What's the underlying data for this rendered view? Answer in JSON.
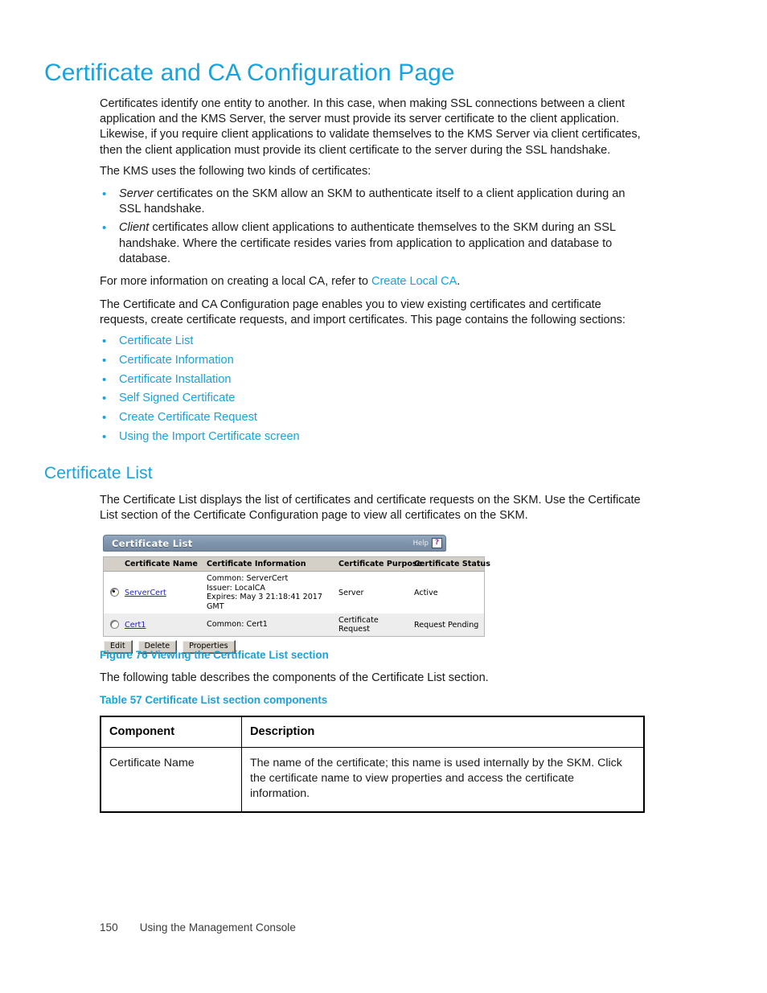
{
  "page": {
    "title": "Certificate and CA Configuration Page",
    "section_heading": "Certificate List",
    "accent_color": "#17a3dc",
    "intro_paragraph": "Certificates identify one entity to another. In this case, when making SSL connections between a client application and the KMS Server, the server must provide its server certificate to the client application. Likewise, if you require client applications to validate themselves to the KMS Server via client certificates, then the client application must provide its client certificate to the server during the SSL handshake.",
    "kinds_lead": "The KMS uses the following two kinds of certificates:",
    "kinds": [
      {
        "emphasis": "Server",
        "rest": " certificates on the SKM allow an SKM to authenticate itself to a client application during an SSL handshake."
      },
      {
        "emphasis": "Client",
        "rest": " certificates allow client applications to authenticate themselves to the SKM during an SSL handshake. Where the certificate resides varies from application to application and database to database."
      }
    ],
    "local_ca_sentence_before": "For more information on creating a local CA, refer to ",
    "local_ca_link": "Create Local CA",
    "local_ca_sentence_after": ".",
    "sections_lead": "The Certificate and CA Configuration page enables you to view existing certificates and certificate requests, create certificate requests, and import certificates. This page contains the following sections:",
    "sections": [
      "Certificate List",
      "Certificate Information",
      "Certificate Installation",
      "Self Signed Certificate",
      "Create Certificate Request",
      "Using the Import Certificate screen"
    ],
    "certificate_list_paragraph": "The Certificate List displays the list of certificates and certificate requests on the SKM. Use the Certificate List section of the Certificate Configuration page to view all certificates on the SKM.",
    "figure_caption": "Figure 76 Viewing the Certificate List section",
    "table_lead": "The following table describes the components of the Certificate List section.",
    "table_caption": "Table 57 Certificate List section components"
  },
  "screenshot": {
    "titlebar": {
      "title": "Certificate List",
      "help_label": "Help",
      "help_icon": "question-mark-icon",
      "bg_color": "#7f96ae"
    },
    "table": {
      "columns": [
        "",
        "Certificate Name",
        "Certificate Information",
        "Certificate Purpose",
        "Certificate Status"
      ],
      "rows": [
        {
          "selected": true,
          "name": "ServerCert",
          "info_lines": [
            "Common: ServerCert",
            "Issuer: LocalCA",
            "Expires: May  3 21:18:41 2017 GMT"
          ],
          "purpose": "Server",
          "status": "Active"
        },
        {
          "selected": false,
          "name": "Cert1",
          "info_lines": [
            "Common: Cert1"
          ],
          "purpose": "Certificate Request",
          "status": "Request Pending"
        }
      ]
    },
    "buttons": [
      "Edit",
      "Delete",
      "Properties"
    ]
  },
  "doc_table": {
    "headers": [
      "Component",
      "Description"
    ],
    "rows": [
      {
        "component": "Certificate Name",
        "description": "The name of the certificate; this name is used internally by the SKM. Click the certificate name to view properties and access the certificate information."
      }
    ]
  },
  "footer": {
    "page_number": "150",
    "chapter": "Using the Management Console"
  }
}
